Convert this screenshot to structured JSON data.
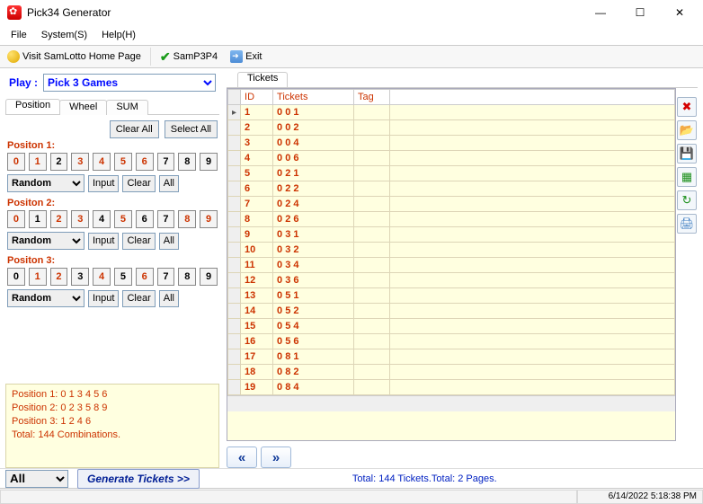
{
  "title": "Pick34 Generator",
  "menus": {
    "file": "File",
    "system": "System(S)",
    "help": "Help(H)"
  },
  "toolbar": {
    "home": "Visit SamLotto Home Page",
    "samp": "SamP3P4",
    "exit": "Exit"
  },
  "play": {
    "label": "Play :",
    "selected": "Pick 3 Games"
  },
  "tabs": {
    "position": "Position",
    "wheel": "Wheel",
    "sum": "SUM"
  },
  "posPanel": {
    "clearAll": "Clear All",
    "selectAll": "Select All",
    "p1": "Positon 1:",
    "p2": "Positon 2:",
    "p3": "Positon 3:",
    "random": "Random",
    "input": "Input",
    "clear": "Clear",
    "all": "All"
  },
  "positions": {
    "p1_sel": [
      0,
      1,
      3,
      4,
      5,
      6
    ],
    "p2_sel": [
      0,
      2,
      3,
      5,
      8,
      9
    ],
    "p3_sel": [
      1,
      2,
      4,
      6
    ]
  },
  "summary": {
    "l1": "Position 1:  0 1 3 4 5 6",
    "l2": "Position 2:  0 2 3 5 8 9",
    "l3": "Position 3:  1 2 4 6",
    "l4": "Total: 144 Combinations."
  },
  "ticketsTab": "Tickets",
  "columns": {
    "id": "ID",
    "tickets": "Tickets",
    "tag": "Tag"
  },
  "rows": [
    {
      "id": "1",
      "tk": "0 0 1"
    },
    {
      "id": "2",
      "tk": "0 0 2"
    },
    {
      "id": "3",
      "tk": "0 0 4"
    },
    {
      "id": "4",
      "tk": "0 0 6"
    },
    {
      "id": "5",
      "tk": "0 2 1"
    },
    {
      "id": "6",
      "tk": "0 2 2"
    },
    {
      "id": "7",
      "tk": "0 2 4"
    },
    {
      "id": "8",
      "tk": "0 2 6"
    },
    {
      "id": "9",
      "tk": "0 3 1"
    },
    {
      "id": "10",
      "tk": "0 3 2"
    },
    {
      "id": "11",
      "tk": "0 3 4"
    },
    {
      "id": "12",
      "tk": "0 3 6"
    },
    {
      "id": "13",
      "tk": "0 5 1"
    },
    {
      "id": "14",
      "tk": "0 5 2"
    },
    {
      "id": "15",
      "tk": "0 5 4"
    },
    {
      "id": "16",
      "tk": "0 5 6"
    },
    {
      "id": "17",
      "tk": "0 8 1"
    },
    {
      "id": "18",
      "tk": "0 8 2"
    },
    {
      "id": "19",
      "tk": "0 8 4"
    }
  ],
  "bottom": {
    "all": "All",
    "generate": "Generate Tickets >>",
    "totals": "Total: 144 Tickets.Total: 2 Pages."
  },
  "status": {
    "datetime": "6/14/2022 5:18:38 PM"
  }
}
